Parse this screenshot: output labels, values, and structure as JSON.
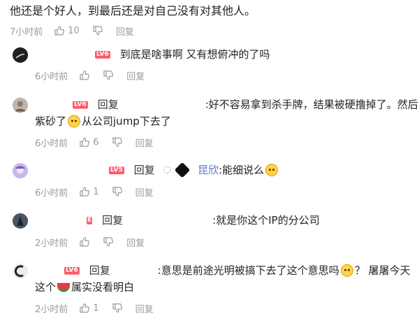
{
  "top_comment": {
    "text": "他还是个好人，到最后还是对自己没有对其他人。",
    "time": "7小时前",
    "likes": "10",
    "reply": "回复"
  },
  "replies": [
    {
      "level": "LV6",
      "text": "到底是啥事啊 又有想俯冲的了吗",
      "time": "6小时前",
      "likes": "",
      "reply": "回复"
    },
    {
      "level": "LV6",
      "reply_label": "回复",
      "line1": ":好不容易拿到杀手牌，结果被硬撸掉了。然后",
      "line2a": "紫砂了",
      "line2b": "从公司jump下去了",
      "time": "6小时前",
      "likes": "6",
      "reply": "回复"
    },
    {
      "level": "LV5",
      "reply_label": "回复",
      "target_tail": "昆欣",
      "text": ":能细说么",
      "time": "6小时前",
      "likes": "1",
      "reply": "回复"
    },
    {
      "level": "",
      "reply_label": "回复",
      "text": ":就是你这个IP的分公司",
      "time": "2小时前",
      "likes": "",
      "reply": "回复"
    },
    {
      "level": "LV6",
      "reply_label": "回复",
      "line1a": ":意思是前途光明被搞下去了这个意思吗",
      "line1b": "？ 屠屠今天",
      "line2a": "这个",
      "line2b": "属实没看明白",
      "time": "2小时前",
      "likes": "1",
      "reply": "回复"
    }
  ],
  "colors": {
    "meta": "#9a9a9a",
    "level_badge": "#ff5c6b"
  }
}
